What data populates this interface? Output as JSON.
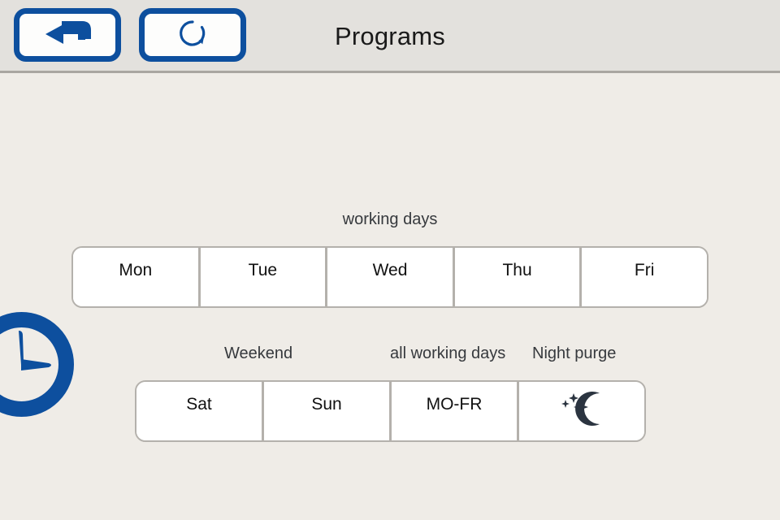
{
  "header": {
    "title": "Programs",
    "back_button": {
      "icon": "back-arrow-icon",
      "label": "Back"
    },
    "reload_button": {
      "icon": "refresh-icon",
      "label": "Refresh"
    }
  },
  "decoration": {
    "clock_icon": "clock-icon"
  },
  "sections": {
    "working_days": {
      "caption": "working days",
      "buttons": [
        {
          "label": "Mon"
        },
        {
          "label": "Tue"
        },
        {
          "label": "Wed"
        },
        {
          "label": "Thu"
        },
        {
          "label": "Fri"
        }
      ]
    },
    "weekend_row": {
      "captions": {
        "weekend": "Weekend",
        "all_working_days": "all working days",
        "night_purge": "Night purge"
      },
      "buttons": [
        {
          "label": "Sat"
        },
        {
          "label": "Sun"
        },
        {
          "label": "MO-FR"
        },
        {
          "label": "",
          "icon": "moon-stars-icon"
        }
      ]
    }
  },
  "colors": {
    "accent_blue": "#0d4f9e",
    "header_background": "#e3e1dd",
    "body_background": "#efece7",
    "button_face": "#ffffff",
    "border_gray": "#b4b1ac",
    "divider_gray": "#a9a6a1",
    "icon_dark": "#2b3440",
    "text_primary": "#111111",
    "caption_gray": "#36393d"
  }
}
